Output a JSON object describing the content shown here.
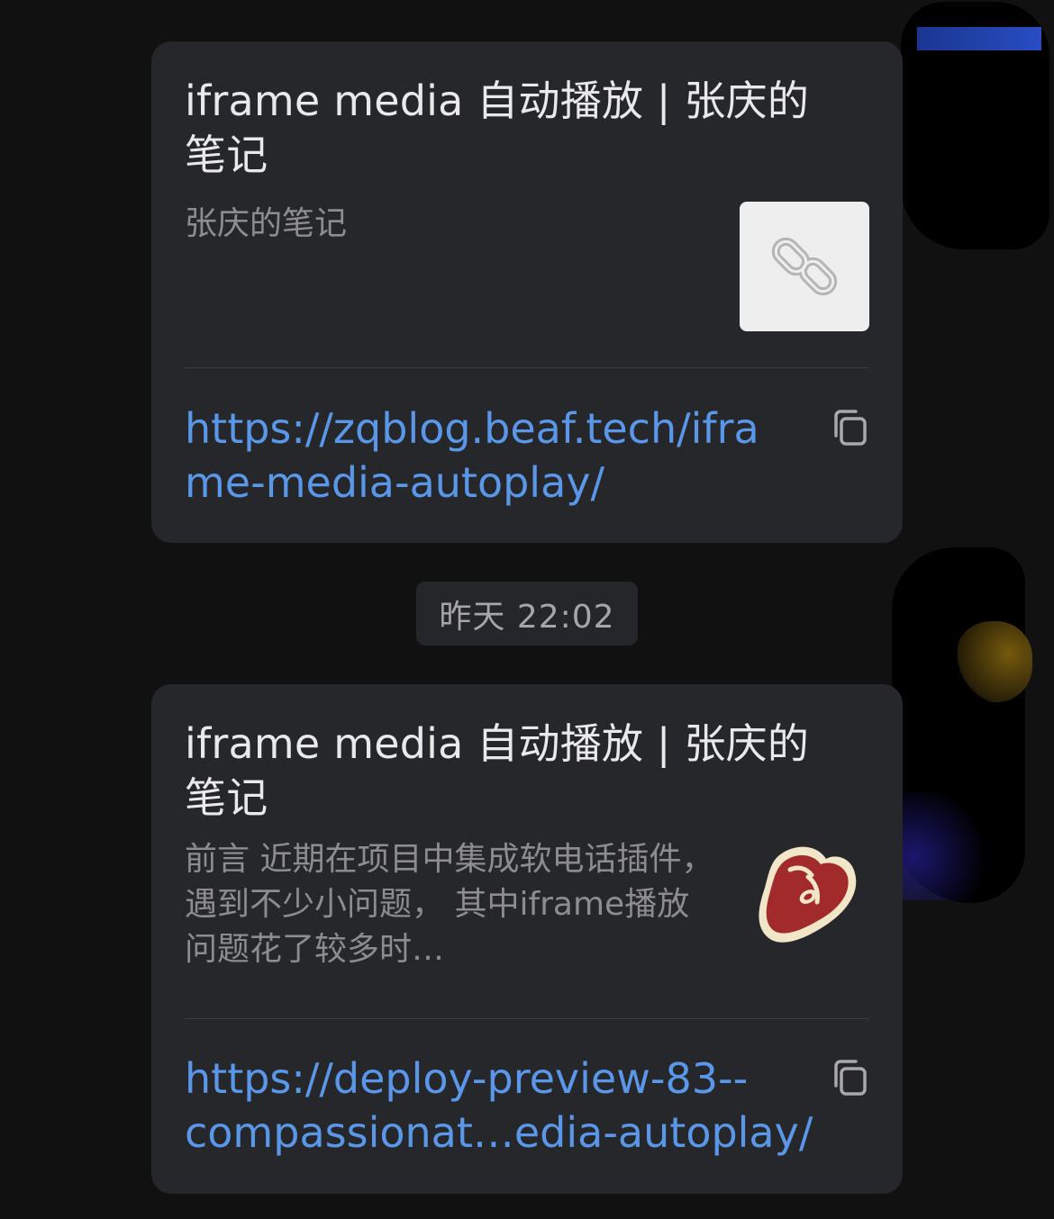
{
  "messages": [
    {
      "title": "iframe media 自动播放 | 张庆的笔记",
      "description": "张庆的笔记",
      "thumbnail_icon": "link-chain-icon",
      "url": "https://zqblog.beaf.tech/iframe-media-autoplay/",
      "copy_icon": "copy-icon"
    },
    {
      "title": "iframe media 自动播放 | 张庆的笔记",
      "description": "前言 近期在项目中集成软电话插件，遇到不少小问题， 其中iframe播放问题花了较多时…",
      "thumbnail_icon": "steak-logo-icon",
      "url": "https://deploy-preview-83--\ncompassionat…edia-autoplay/",
      "copy_icon": "copy-icon"
    }
  ],
  "timestamp": "昨天 22:02",
  "colors": {
    "background": "#111112",
    "card": "#26272a",
    "link": "#5a97e8",
    "muted_text": "#8d8d90"
  }
}
